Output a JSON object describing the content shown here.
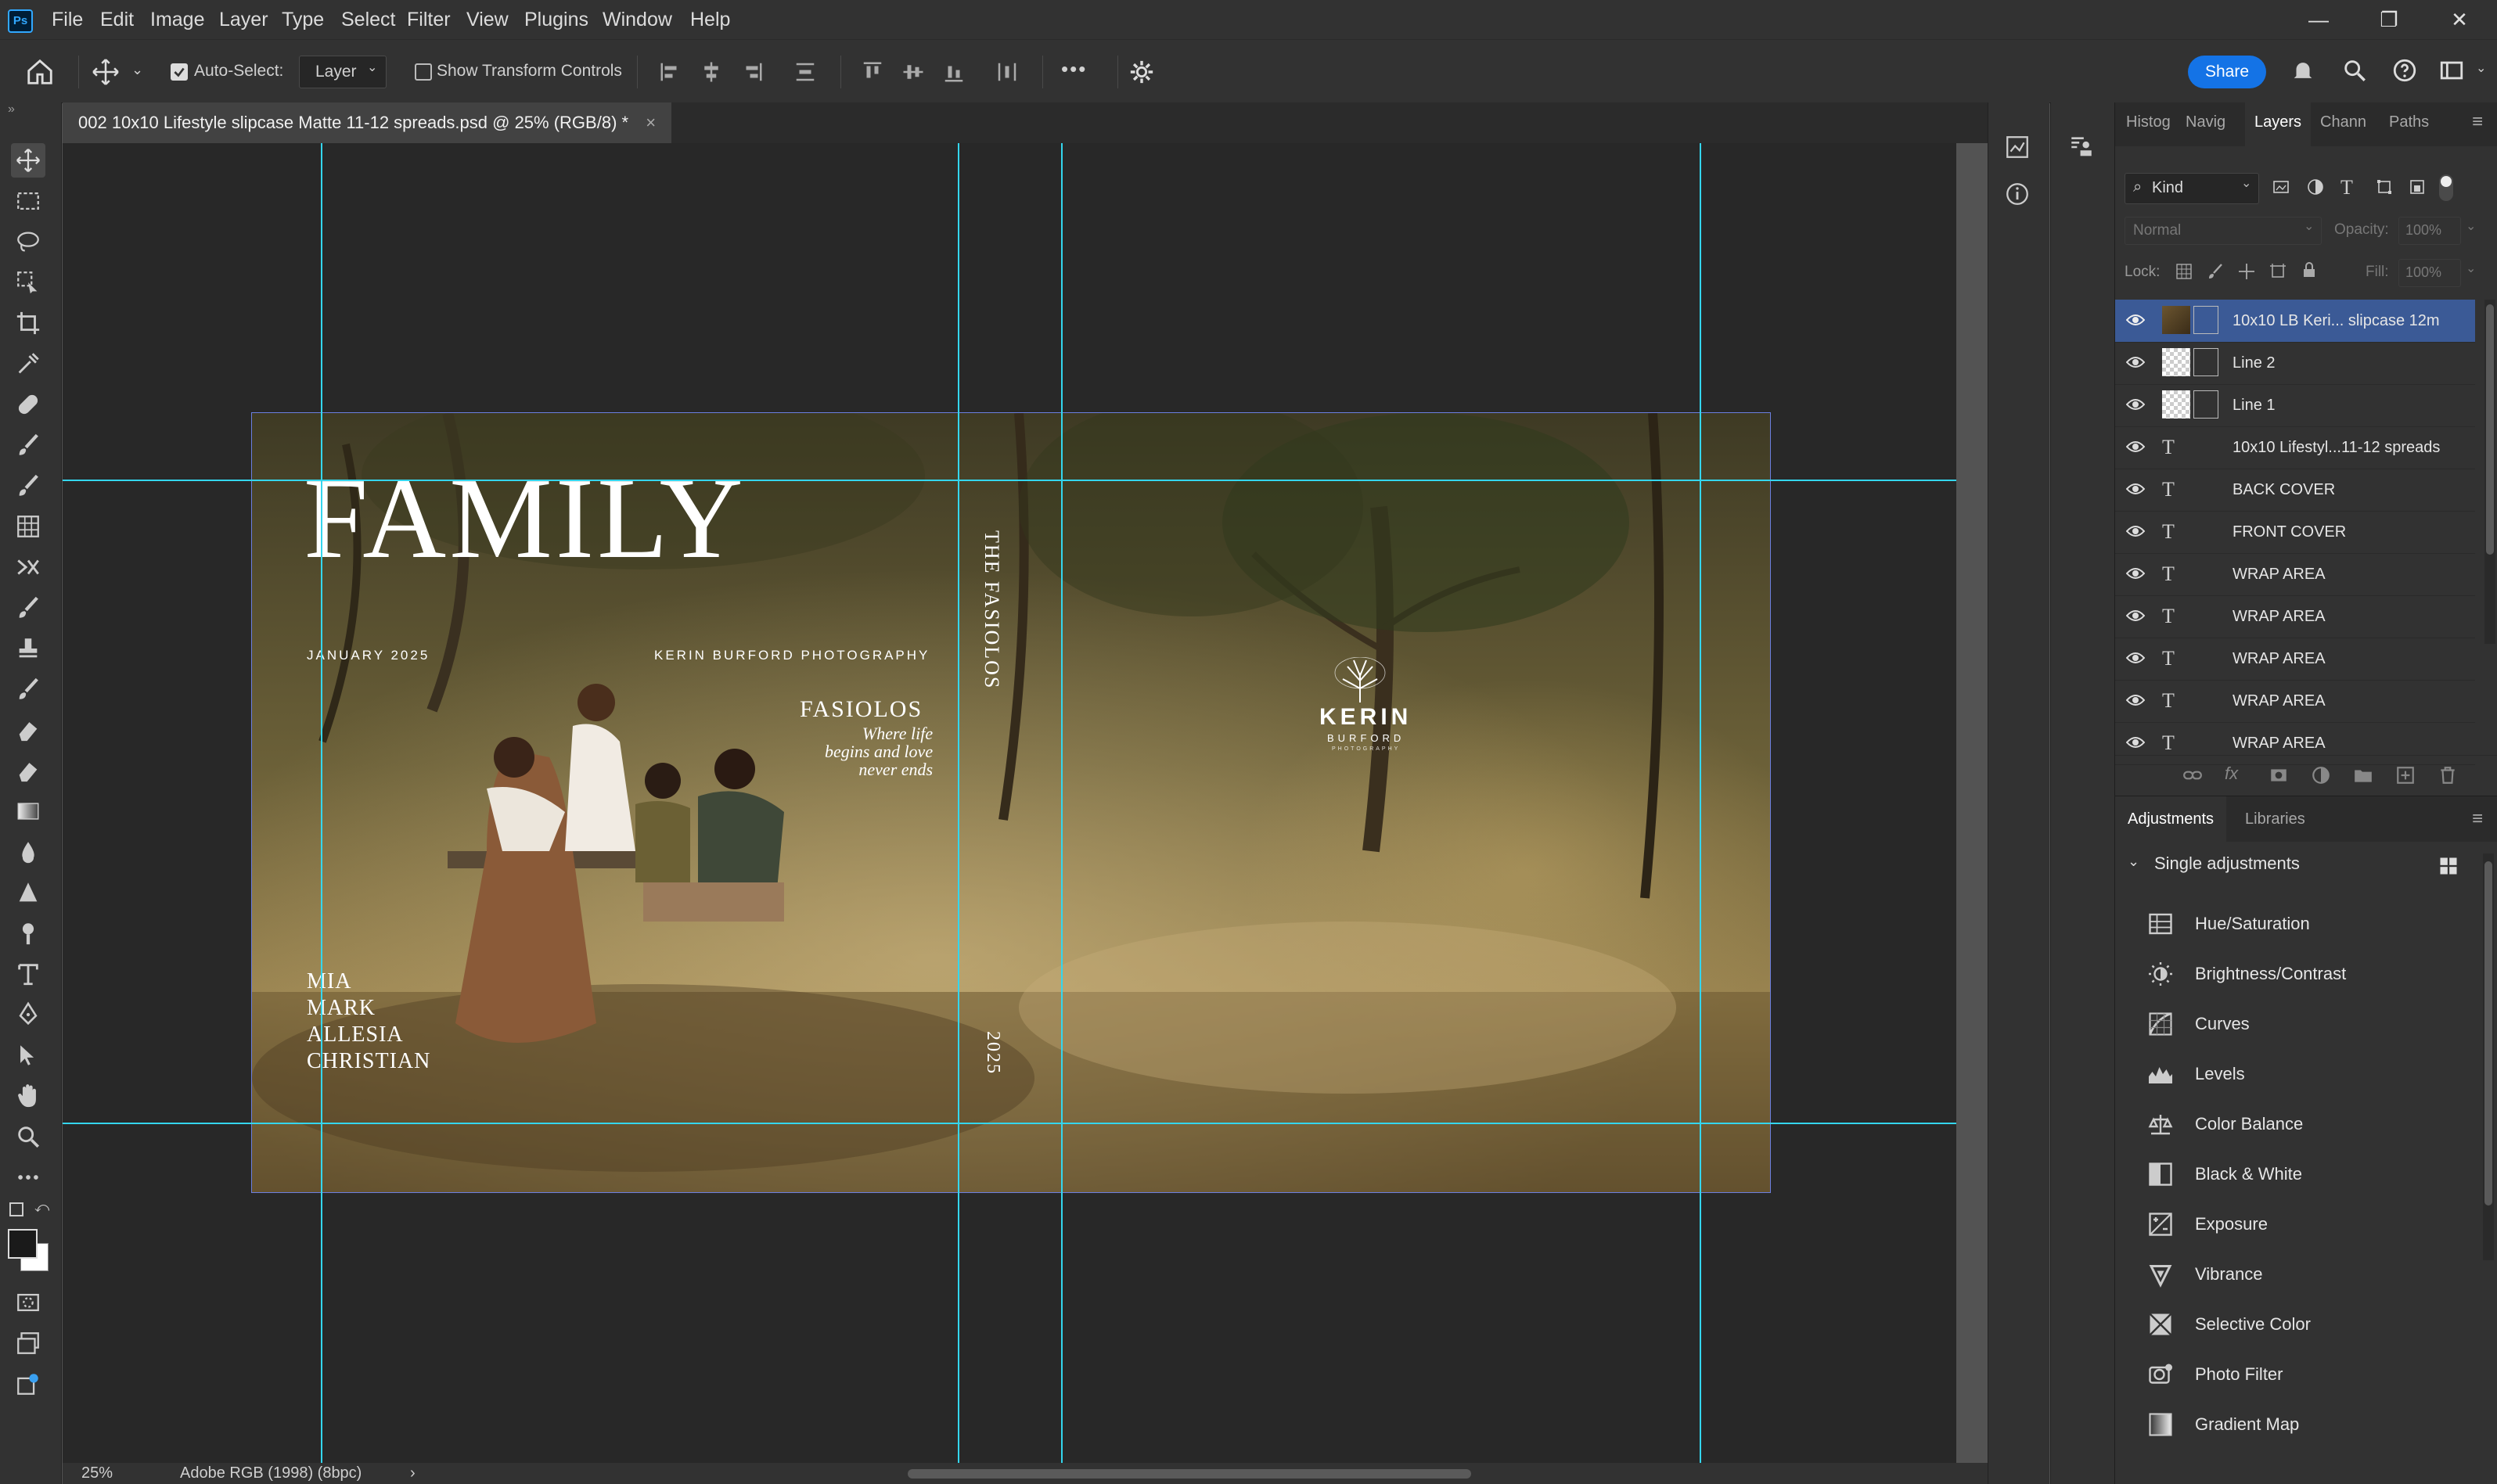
{
  "app": {
    "logo": "Ps"
  },
  "menu": [
    "File",
    "Edit",
    "Image",
    "Layer",
    "Type",
    "Select",
    "Filter",
    "View",
    "Plugins",
    "Window",
    "Help"
  ],
  "window_controls": {
    "minimize": "—",
    "restore": "❐",
    "close": "✕"
  },
  "options_bar": {
    "auto_select_label": "Auto-Select:",
    "auto_select_checked": true,
    "target_value": "Layer",
    "transform_label": "Show Transform Controls",
    "transform_checked": false,
    "more": "•••",
    "share_label": "Share"
  },
  "document": {
    "tab_title": "002 10x10 Lifestyle slipcase Matte 11-12 spreads.psd @ 25% (RGB/8) *",
    "close_glyph": "×"
  },
  "artwork": {
    "title": "FAMILY",
    "date": "JANUARY 2025",
    "studio": "KERIN BURFORD PHOTOGRAPHY",
    "family_name": "FASIOLOS",
    "tagline_lines": [
      "Where life",
      "begins and love",
      "never ends"
    ],
    "names": [
      "MIA",
      "MARK",
      "ALLESIA",
      "CHRISTIAN"
    ],
    "spine_title": "THE FASIOLOS",
    "spine_year": "2025",
    "logo_name": "KERIN",
    "logo_sub": "BURFORD",
    "logo_tiny": "PHOTOGRAPHY"
  },
  "status_bar": {
    "zoom": "25%",
    "profile": "Adobe RGB (1998) (8bpc)",
    "arrow": "›"
  },
  "panels": {
    "top_tabs": [
      "Histog",
      "Navig",
      "Layers",
      "Chann",
      "Paths"
    ],
    "active_tab": "Layers",
    "filter_kind": "Kind",
    "blend_mode": "Normal",
    "opacity_label": "Opacity:",
    "opacity_value": "100%",
    "lock_label": "Lock:",
    "fill_label": "Fill:",
    "fill_value": "100%",
    "layers": [
      {
        "name": "10x10 LB Keri... slipcase 12m",
        "type": "smart",
        "selected": true
      },
      {
        "name": "Line 2",
        "type": "smart",
        "selected": false
      },
      {
        "name": "Line 1",
        "type": "smart",
        "selected": false
      },
      {
        "name": "10x10 Lifestyl...11-12 spreads",
        "type": "text",
        "selected": false
      },
      {
        "name": "BACK COVER",
        "type": "text",
        "selected": false
      },
      {
        "name": "FRONT COVER",
        "type": "text",
        "selected": false
      },
      {
        "name": "WRAP AREA",
        "type": "text",
        "selected": false
      },
      {
        "name": "WRAP AREA",
        "type": "text",
        "selected": false
      },
      {
        "name": "WRAP AREA",
        "type": "text",
        "selected": false
      },
      {
        "name": "WRAP AREA",
        "type": "text",
        "selected": false
      },
      {
        "name": "WRAP AREA",
        "type": "text",
        "selected": false
      }
    ],
    "bottom_tabs": [
      "Adjustments",
      "Libraries"
    ],
    "section_title": "Single adjustments",
    "adjustments": [
      "Hue/Saturation",
      "Brightness/Contrast",
      "Curves",
      "Levels",
      "Color Balance",
      "Black & White",
      "Exposure",
      "Vibrance",
      "Selective Color",
      "Photo Filter",
      "Gradient Map"
    ]
  },
  "colors": {
    "accent": "#1473e6",
    "guide": "#34d6ee",
    "selected_layer": "#3b5a96",
    "panel": "#323232"
  }
}
